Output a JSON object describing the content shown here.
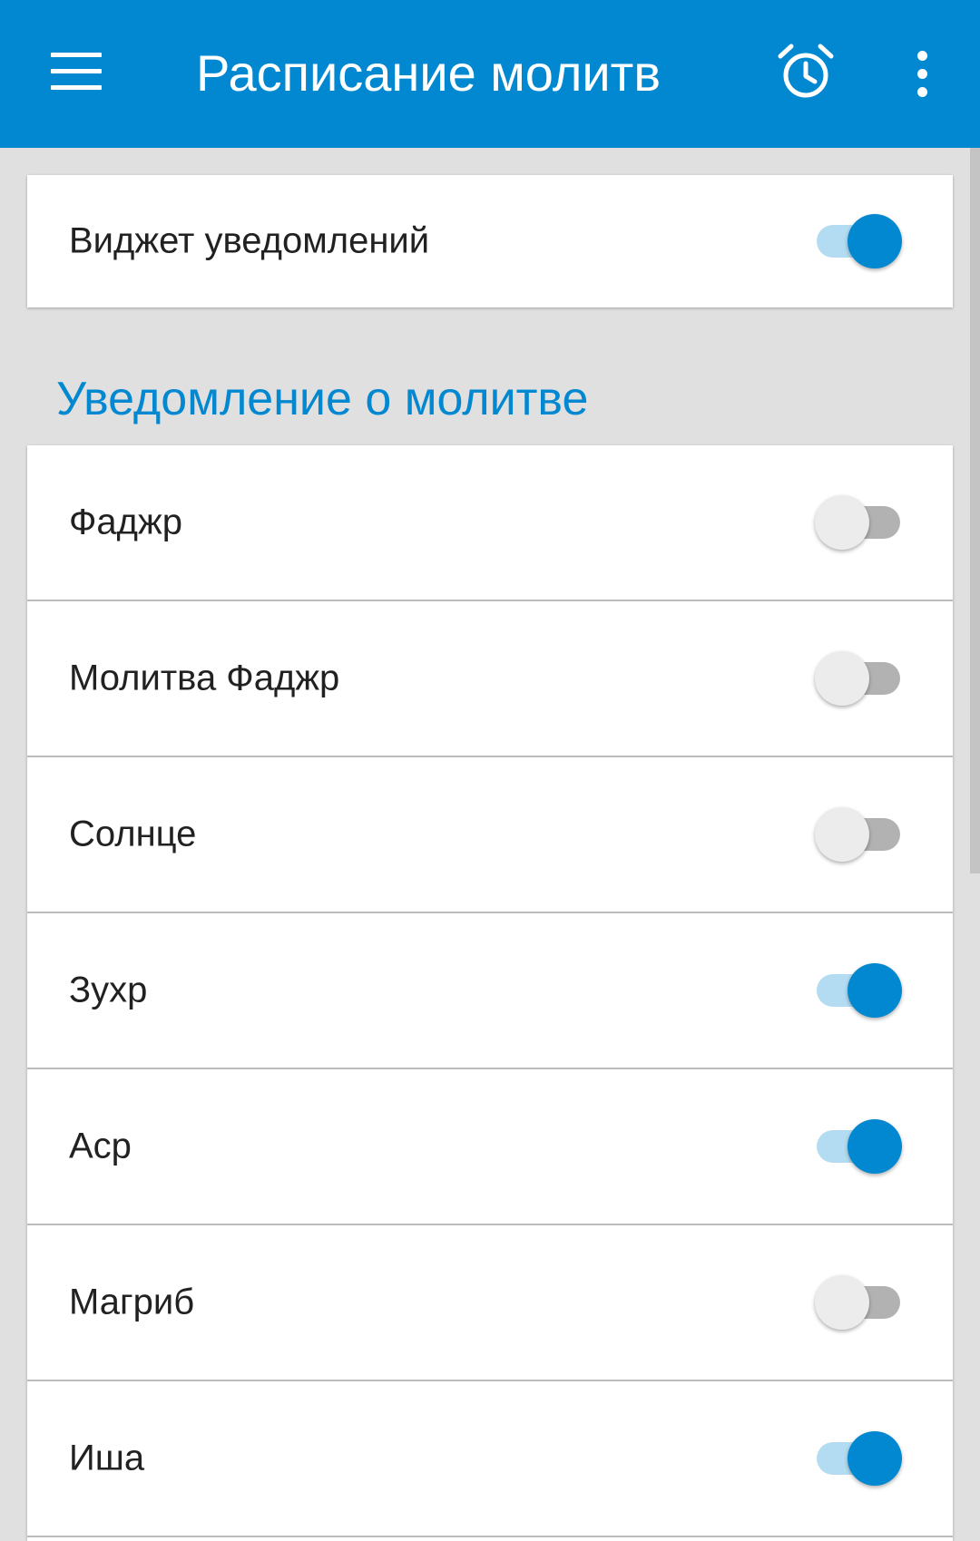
{
  "appbar": {
    "title": "Расписание молитв",
    "color": "#0288d1",
    "menu_icon": "hamburger-menu-icon",
    "alarm_icon": "alarm-clock-icon",
    "more_icon": "more-vertical-icon"
  },
  "widget": {
    "label": "Виджет уведомлений",
    "enabled": true
  },
  "section": {
    "title": "Уведомление о молитве"
  },
  "prayers": [
    {
      "label": "Фаджр",
      "enabled": false
    },
    {
      "label": "Молитва Фаджр",
      "enabled": false
    },
    {
      "label": "Солнце",
      "enabled": false
    },
    {
      "label": "Зухр",
      "enabled": true
    },
    {
      "label": "Аср",
      "enabled": true
    },
    {
      "label": "Магриб",
      "enabled": false
    },
    {
      "label": "Иша",
      "enabled": true
    }
  ],
  "colors": {
    "accent": "#0288d1",
    "switch_on_track": "#b3dcf3",
    "switch_off_thumb": "#ececec",
    "switch_off_track": "#b2b2b2"
  }
}
